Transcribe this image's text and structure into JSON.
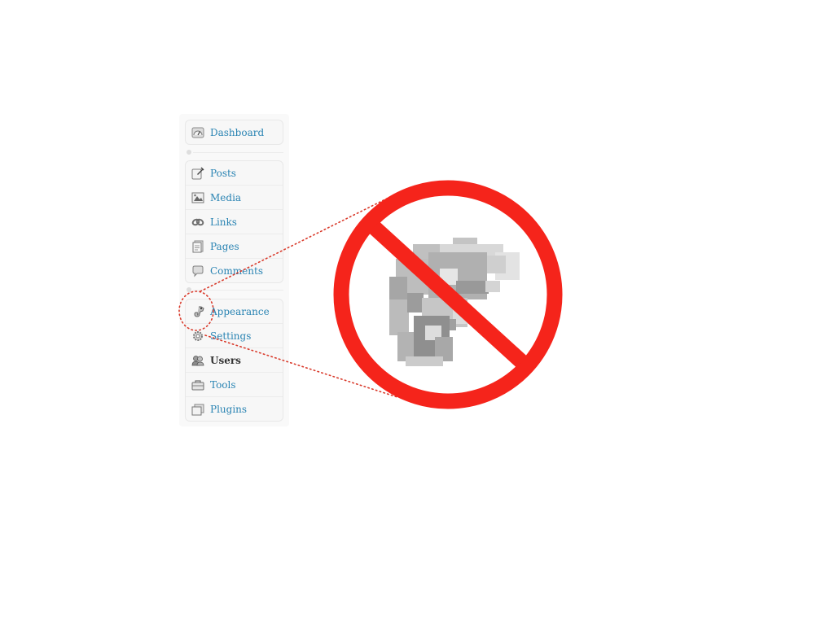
{
  "admin_menu": {
    "dashboard": {
      "label": "Dashboard",
      "icon": "dashboard-icon"
    },
    "content_items": [
      {
        "label": "Posts",
        "icon": "posts-icon"
      },
      {
        "label": "Media",
        "icon": "media-icon"
      },
      {
        "label": "Links",
        "icon": "links-icon"
      },
      {
        "label": "Pages",
        "icon": "pages-icon"
      },
      {
        "label": "Comments",
        "icon": "comments-icon"
      }
    ],
    "admin_items": [
      {
        "label": "Appearance",
        "icon": "appearance-chameleon-icon"
      },
      {
        "label": "Settings",
        "icon": "settings-gear-icon"
      },
      {
        "label": "Users",
        "icon": "users-icon",
        "current": true
      },
      {
        "label": "Tools",
        "icon": "tools-icon"
      },
      {
        "label": "Plugins",
        "icon": "plugins-icon"
      }
    ]
  },
  "overlay": {
    "highlight_target": "Appearance",
    "symbol": "prohibition-sign",
    "magnified_icon": "chameleon-icon",
    "colors": {
      "prohibition_red": "#f5241b",
      "callout_dots": "#d93a2b",
      "link_blue": "#2a84b3",
      "current_text": "#333333"
    }
  }
}
